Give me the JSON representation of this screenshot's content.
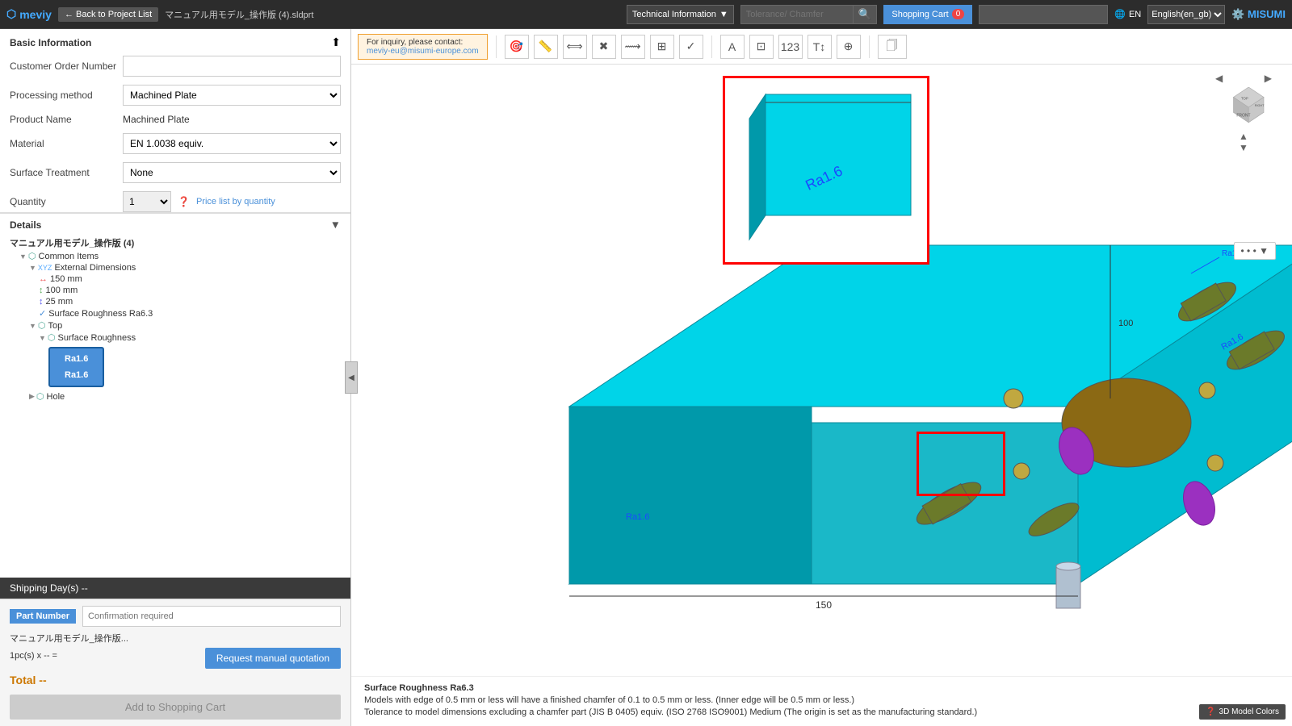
{
  "header": {
    "logo": "meviy",
    "back_btn": "← Back to Project List",
    "filename": "マニュアル用モデル_操作版 (4).sldprt",
    "technical_info_label": "Technical Information",
    "tolerance_placeholder": "Tolerance/ Chamfer",
    "cart_label": "Shopping Cart",
    "cart_count": "0",
    "lang_label": "EN",
    "lang_select": "English(en_gb)",
    "brand": "MISUMI"
  },
  "sidebar": {
    "basic_info_title": "Basic Information",
    "customer_order_label": "Customer Order Number",
    "customer_order_placeholder": "",
    "processing_method_label": "Processing method",
    "processing_method_value": "Machined Plate",
    "product_name_label": "Product Name",
    "product_name_value": "Machined Plate",
    "material_label": "Material",
    "material_value": "EN 1.0038 equiv.",
    "surface_treatment_label": "Surface Treatment",
    "surface_treatment_value": "None",
    "quantity_label": "Quantity",
    "quantity_value": "1",
    "price_list_link": "Price list by quantity",
    "details_title": "Details",
    "tree_root": "マニュアル用モデル_操作版 (4)",
    "tree_items": [
      {
        "label": "Common Items",
        "indent": 1,
        "icon": "folder"
      },
      {
        "label": "External Dimensions",
        "indent": 2,
        "icon": "folder"
      },
      {
        "label": "150 mm",
        "indent": 3,
        "icon": "x-dim"
      },
      {
        "label": "100 mm",
        "indent": 3,
        "icon": "y-dim"
      },
      {
        "label": "25 mm",
        "indent": 3,
        "icon": "z-dim"
      },
      {
        "label": "Surface Roughness Ra6.3",
        "indent": 3,
        "icon": "check"
      },
      {
        "label": "Top",
        "indent": 2,
        "icon": "folder"
      },
      {
        "label": "Surface Roughness",
        "indent": 3,
        "icon": "folder"
      },
      {
        "label": "Ra1.6",
        "indent": 4,
        "icon": "ra-badge"
      },
      {
        "label": "Ra1.6",
        "indent": 4,
        "icon": "ra-badge"
      },
      {
        "label": "Hole",
        "indent": 2,
        "icon": "folder"
      }
    ],
    "shipping_label": "Shipping Day(s) --",
    "part_number_label": "Part Number",
    "part_number_placeholder": "Confirmation required",
    "file_name": "マニュアル用モデル_操作版...",
    "qty_info": "1pc(s)  x -- =",
    "total_label": "Total --",
    "quote_btn": "Request manual quotation",
    "add_cart_btn": "Add to Shopping Cart"
  },
  "viewport": {
    "inquiry_text": "For inquiry, please contact:",
    "inquiry_email": "meviy-eu@misumi-europe.com",
    "surface_roughness_title": "Surface Roughness Ra6.3",
    "info_line1": "Models with edge of 0.5 mm or less will have a finished chamfer of 0.1 to 0.5 mm or less. (Inner edge will be 0.5 mm or less.)",
    "info_line2": "Tolerance to model dimensions excluding a chamfer part (JIS B 0405) equiv. (ISO 2768 ISO9001) Medium (The origin is set as the manufacturing standard.)",
    "colors_btn": "3D Model Colors"
  }
}
